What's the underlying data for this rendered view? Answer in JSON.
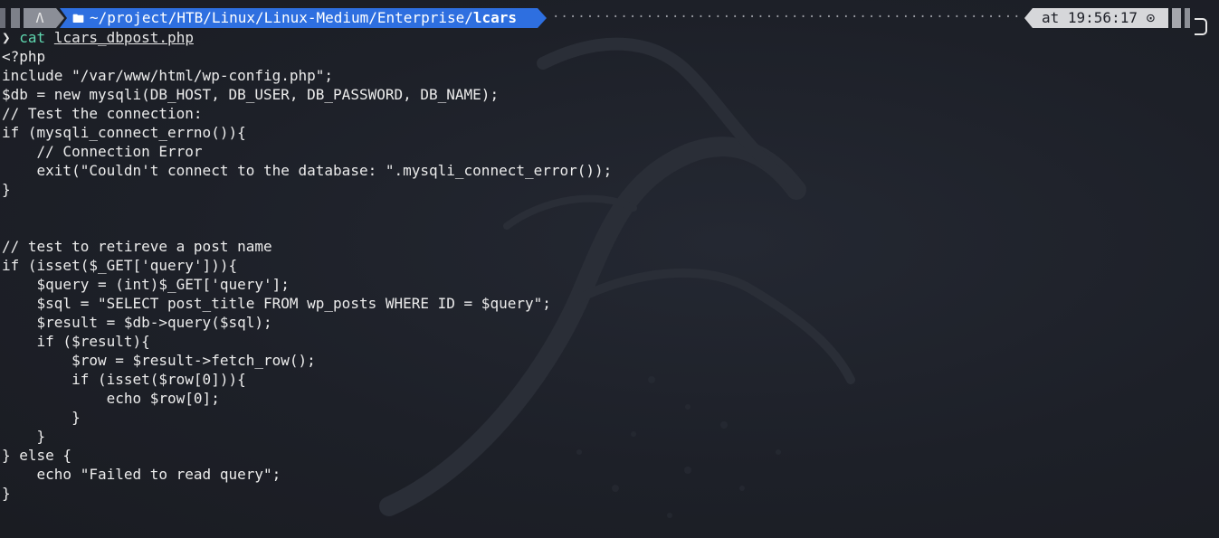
{
  "prompt": {
    "os_icon": "linux-tux-icon",
    "os_glyph": "Λ",
    "folder_icon": "folder-icon",
    "path_prefix": "~/project/HTB/Linux/Linux-Medium/Enterprise/",
    "path_current": "lcars",
    "time_label": "at 19:56:17 ⊙",
    "time_icon": "clock-icon"
  },
  "command": {
    "arrow": "❯",
    "name": "cat",
    "argument": "lcars_dbpost.php"
  },
  "output_lines": [
    "<?php",
    "include \"/var/www/html/wp-config.php\";",
    "$db = new mysqli(DB_HOST, DB_USER, DB_PASSWORD, DB_NAME);",
    "// Test the connection:",
    "if (mysqli_connect_errno()){",
    "    // Connection Error",
    "    exit(\"Couldn't connect to the database: \".mysqli_connect_error());",
    "}",
    "",
    "",
    "// test to retireve a post name",
    "if (isset($_GET['query'])){",
    "    $query = (int)$_GET['query'];",
    "    $sql = \"SELECT post_title FROM wp_posts WHERE ID = $query\";",
    "    $result = $db->query($sql);",
    "    if ($result){",
    "        $row = $result->fetch_row();",
    "        if (isset($row[0])){",
    "            echo $row[0];",
    "        }",
    "    }",
    "} else {",
    "    echo \"Failed to read query\";",
    "}"
  ],
  "colors": {
    "background": "#1c1f26",
    "path_segment": "#2e6fe0",
    "time_segment": "#d6d7da",
    "command_name": "#5fd7af",
    "text": "#ececec"
  }
}
